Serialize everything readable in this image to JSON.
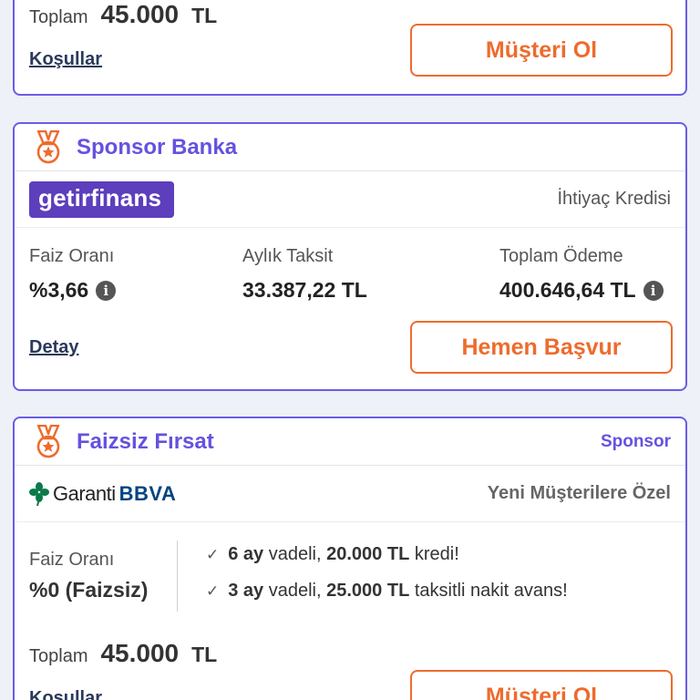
{
  "top_card": {
    "total_label": "Toplam",
    "total_amount": "45.000",
    "total_currency": "TL",
    "conditions_link": "Koşullar",
    "cta": "Müşteri Ol"
  },
  "sponsor_card": {
    "title": "Sponsor Banka",
    "bank_logo_text": "getirfinans",
    "product": "İhtiyaç Kredisi",
    "stats": [
      {
        "label": "Faiz Oranı",
        "value": "%3,66",
        "info": true
      },
      {
        "label": "Aylık Taksit",
        "value": "33.387,22 TL",
        "info": false
      },
      {
        "label": "Toplam Ödeme",
        "value": "400.646,64 TL",
        "info": true
      }
    ],
    "detail_link": "Detay",
    "cta": "Hemen Başvur"
  },
  "faizsiz_card": {
    "title": "Faizsiz Fırsat",
    "sponsor_tag": "Sponsor",
    "bank_name": "Garanti",
    "bank_suffix": "BBVA",
    "product": "Yeni Müşterilere Özel",
    "rate_label": "Faiz Oranı",
    "rate_value": "%0 (Faizsiz)",
    "features": [
      {
        "b1": "6 ay",
        "t1": " vadeli, ",
        "b2": "20.000 TL",
        "t2": " kredi!"
      },
      {
        "b1": "3 ay",
        "t1": " vadeli, ",
        "b2": "25.000 TL",
        "t2": " taksitli nakit avans!"
      }
    ],
    "total_label": "Toplam",
    "total_amount": "45.000",
    "total_currency": "TL",
    "conditions_link": "Koşullar",
    "cta": "Müşteri Ol"
  },
  "icons": {
    "medal": "medal-icon",
    "info": "info-icon",
    "check": "check-icon",
    "garanti_clover": "clover-icon"
  },
  "colors": {
    "accent_purple": "#6452e0",
    "cta_orange": "#ee6b2d",
    "getir_purple": "#5d3ebc",
    "garanti_green": "#0a7a4a"
  }
}
